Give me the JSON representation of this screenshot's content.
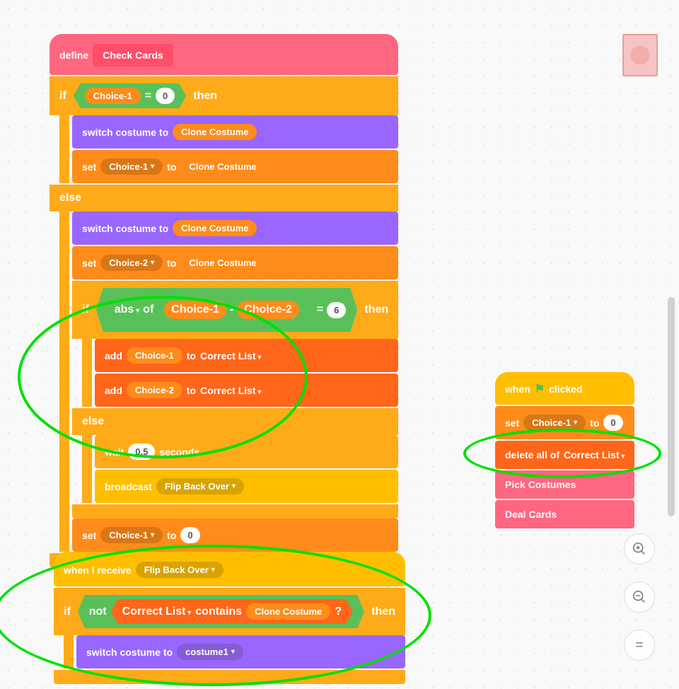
{
  "define": {
    "label": "define",
    "proc": "Check Cards"
  },
  "if1": {
    "if": "if",
    "then": "then",
    "cond": {
      "var": "Choice-1",
      "op": "=",
      "val": "0"
    },
    "switch1": {
      "label": "switch costume to",
      "val": "Clone Costume"
    },
    "set1": {
      "label": "set",
      "var": "Choice-1",
      "to": "to",
      "val": "Clone Costume"
    },
    "else": "else",
    "switch2": {
      "label": "switch costume to",
      "val": "Clone Costume"
    },
    "set2": {
      "label": "set",
      "var": "Choice-2",
      "to": "to",
      "val": "Clone Costume"
    },
    "if2": {
      "if": "if",
      "then": "then",
      "cond": {
        "fn": "abs",
        "of": "of",
        "a": "Choice-1",
        "minus": "-",
        "b": "Choice-2",
        "op": "=",
        "val": "6"
      },
      "add1": {
        "label": "add",
        "var": "Choice-1",
        "to": "to",
        "list": "Correct List"
      },
      "add2": {
        "label": "add",
        "var": "Choice-2",
        "to": "to",
        "list": "Correct List"
      },
      "else": "else",
      "wait": {
        "label": "wait",
        "val": "0.5",
        "unit": "seconds"
      },
      "bcast": {
        "label": "broadcast",
        "msg": "Flip Back Over"
      }
    },
    "set3": {
      "label": "set",
      "var": "Choice-1",
      "to": "to",
      "val": "0"
    }
  },
  "recv": {
    "label": "when I receive",
    "msg": "Flip Back Over",
    "if": {
      "if": "if",
      "not": "not",
      "list": "Correct List",
      "contains": "contains",
      "item": "Clone Costume",
      "q": "?",
      "then": "then"
    },
    "switch": {
      "label": "switch costume to",
      "val": "costume1"
    }
  },
  "flag": {
    "label": "when",
    "clicked": "clicked",
    "set": {
      "label": "set",
      "var": "Choice-1",
      "to": "to",
      "val": "0"
    },
    "del": {
      "label": "delete all of",
      "list": "Correct List"
    },
    "pick": "Pick Costumes",
    "deal": "Deal Cards"
  }
}
